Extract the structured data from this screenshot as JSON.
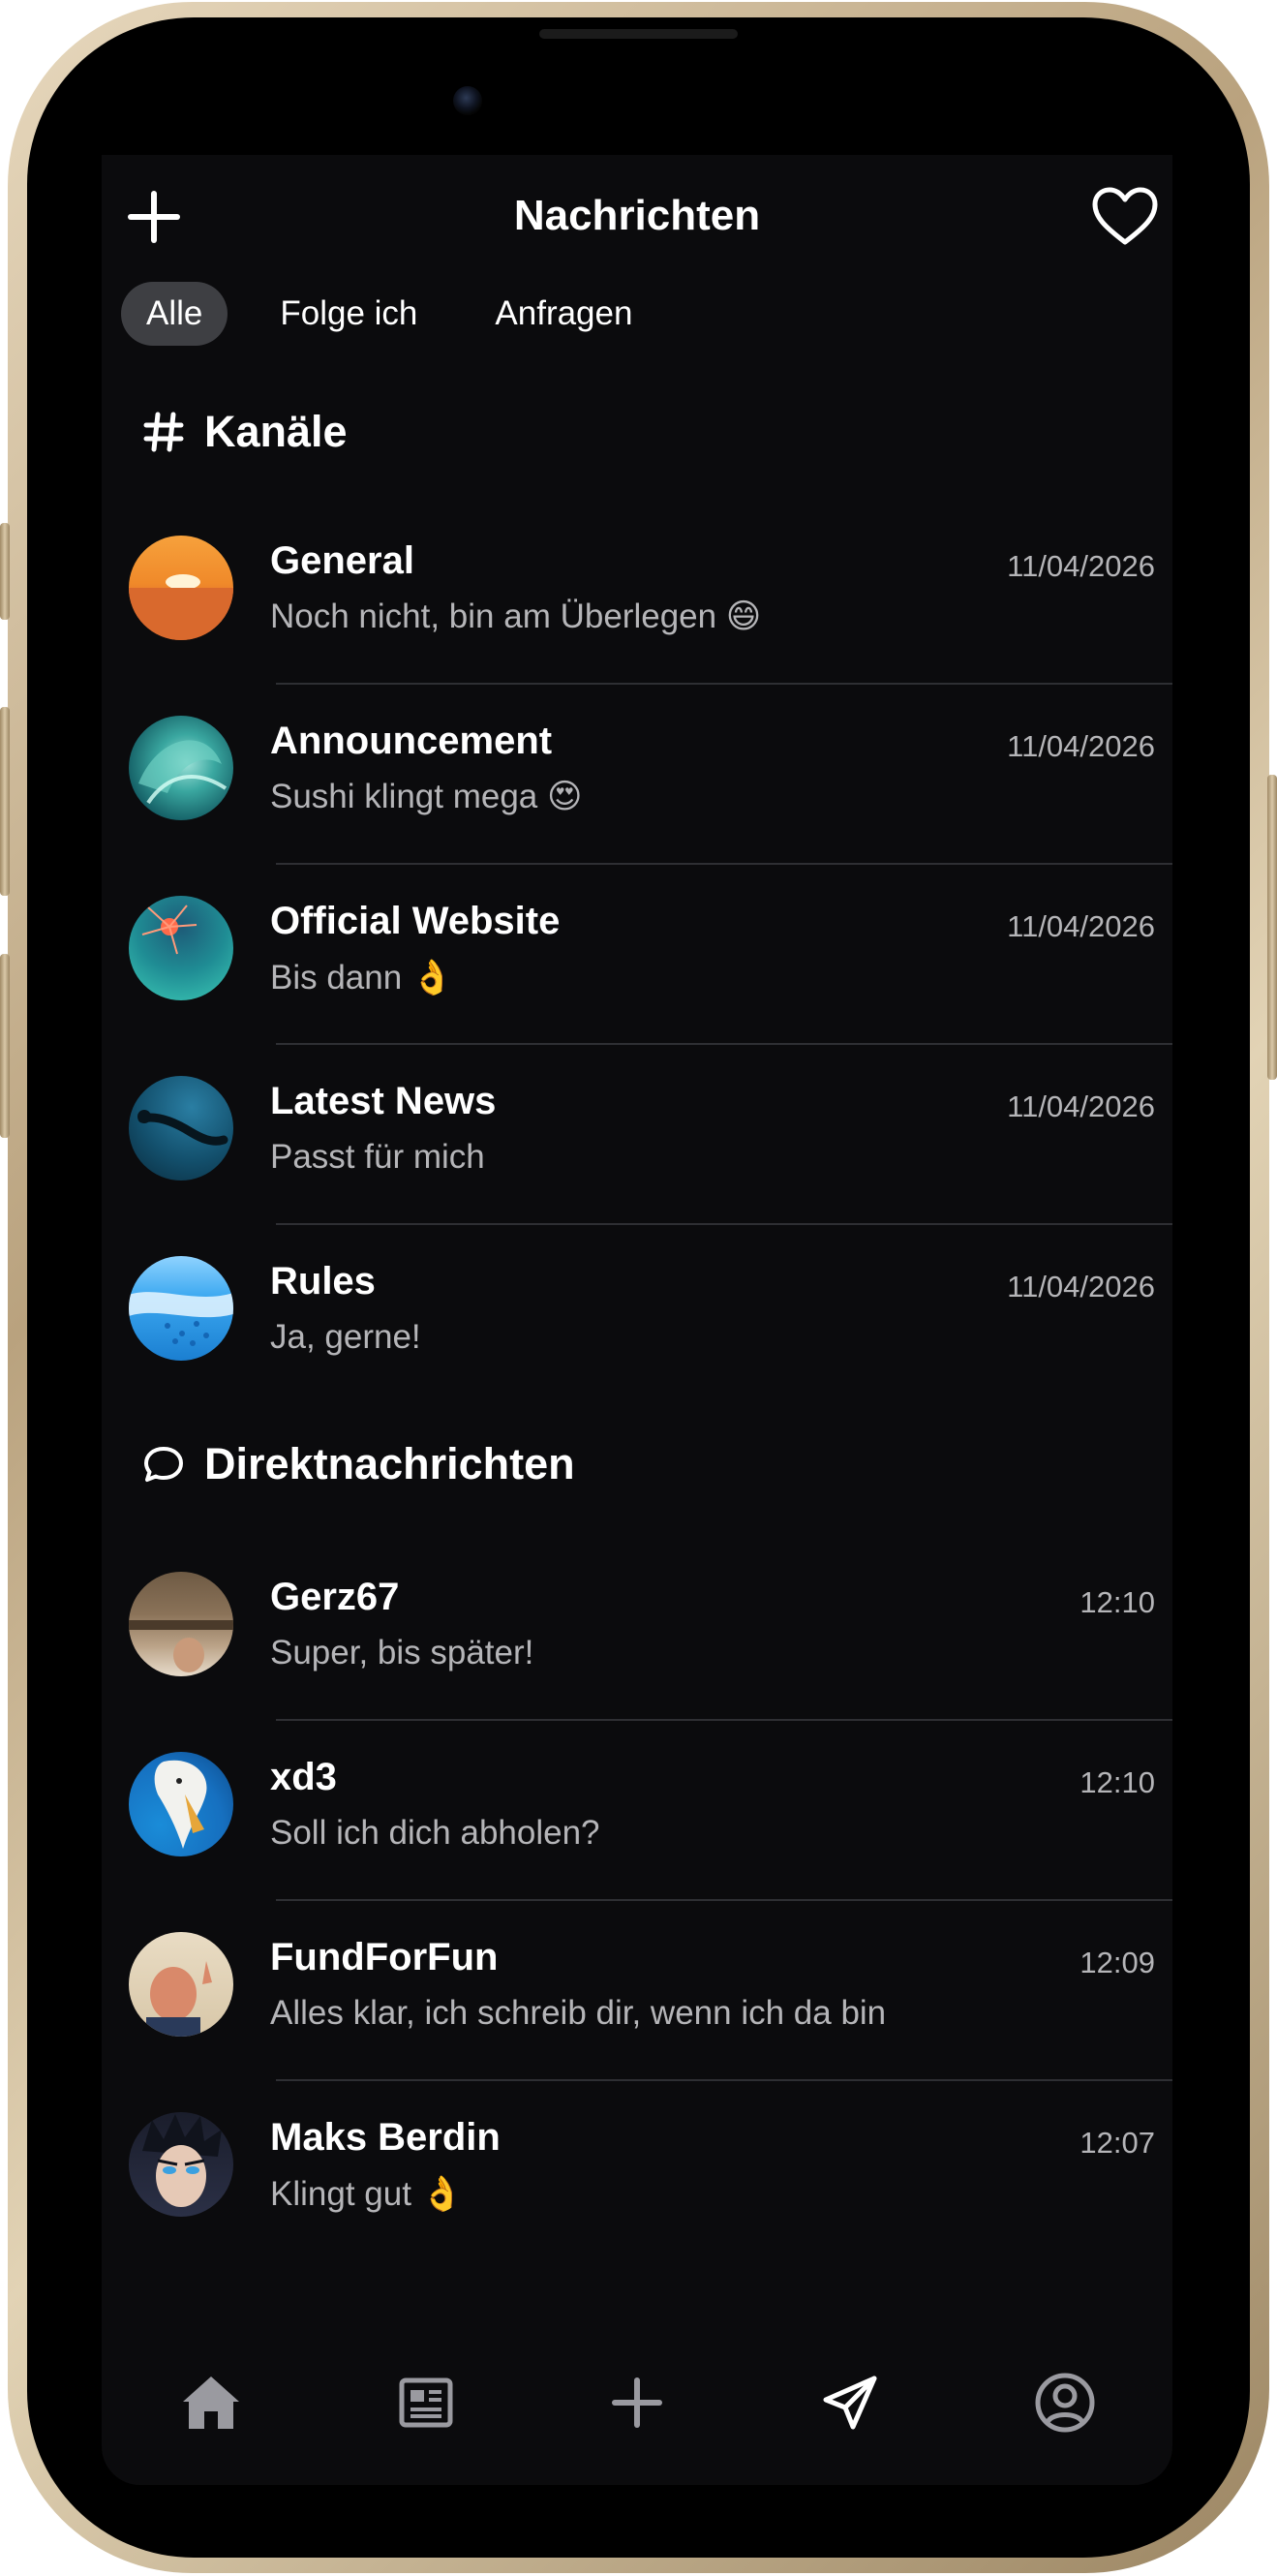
{
  "header": {
    "title": "Nachrichten",
    "add_icon": "plus-icon",
    "heart_icon": "heart-icon"
  },
  "filters": [
    {
      "label": "Alle",
      "active": true
    },
    {
      "label": "Folge ich",
      "active": false
    },
    {
      "label": "Anfragen",
      "active": false
    }
  ],
  "channels": {
    "heading": "Kanäle",
    "icon": "hashtag-icon",
    "items": [
      {
        "name": "General",
        "message": "Noch nicht, bin am Überlegen 😄",
        "time": "11/04/2026"
      },
      {
        "name": "Announcement",
        "message": "Sushi klingt mega 😍",
        "time": "11/04/2026"
      },
      {
        "name": "Official Website",
        "message": "Bis dann 👌",
        "time": "11/04/2026"
      },
      {
        "name": "Latest News",
        "message": "Passt für mich",
        "time": "11/04/2026"
      },
      {
        "name": "Rules",
        "message": "Ja, gerne!",
        "time": "11/04/2026"
      }
    ]
  },
  "direct": {
    "heading": "Direktnachrichten",
    "icon": "chat-bubble-icon",
    "items": [
      {
        "name": "Gerz67",
        "message": "Super, bis später!",
        "time": "12:10"
      },
      {
        "name": "xd3",
        "message": "Soll ich dich abholen?",
        "time": "12:10"
      },
      {
        "name": "FundForFun",
        "message": "Alles klar, ich schreib dir, wenn ich da bin",
        "time": "12:09"
      },
      {
        "name": "Maks Berdin",
        "message": "Klingt gut 👌",
        "time": "12:07"
      }
    ]
  },
  "tabbar": {
    "items": [
      "home-icon",
      "news-icon",
      "plus-icon",
      "send-icon",
      "profile-icon"
    ],
    "active": "send-icon"
  },
  "colors": {
    "background": "#0b0b0d",
    "text_primary": "#ffffff",
    "text_secondary": "#b5b5b8",
    "chip_active": "#3e3f43",
    "divider": "#2e2f33",
    "frame_gold": "#c8b48f"
  }
}
